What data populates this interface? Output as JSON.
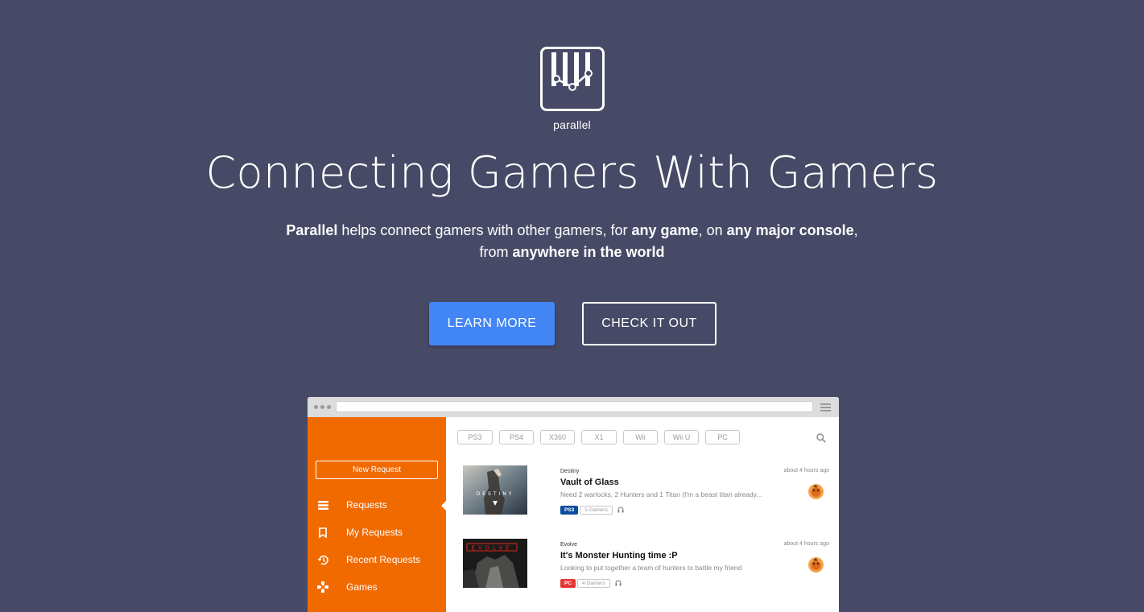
{
  "brand": {
    "name": "parallel"
  },
  "hero": {
    "title": "Connecting Gamers With Gamers",
    "sub_line1_parts": [
      "Parallel",
      " helps connect gamers with other gamers, for ",
      "any game",
      ", on ",
      "any major console",
      ","
    ],
    "sub_line2_parts": [
      "from ",
      "anywhere in the world"
    ]
  },
  "buttons": {
    "learn_more": "LEARN MORE",
    "check_it_out": "CHECK IT OUT"
  },
  "colors": {
    "background": "#474a66",
    "primary": "#4285f4",
    "sidebar": "#f16a00"
  },
  "app": {
    "sidebar": {
      "new_request": "New Request",
      "items": [
        {
          "label": "Requests",
          "icon": "list-icon",
          "active": true
        },
        {
          "label": "My Requests",
          "icon": "bookmark-icon"
        },
        {
          "label": "Recent Requests",
          "icon": "history-icon"
        },
        {
          "label": "Games",
          "icon": "gamepad-icon"
        }
      ]
    },
    "filters": [
      "PS3",
      "PS4",
      "X360",
      "X1",
      "Wii",
      "Wii U",
      "PC"
    ],
    "requests": [
      {
        "game": "Destiny",
        "title": "Vault of Glass",
        "desc": "Need 2 warlocks, 2 Hunters and 1 Titan (I'm a beast titan already...",
        "platform": "PS3",
        "platform_color": "#0a4d9e",
        "gamers": "5 Gamers",
        "time": "about 4 hours ago",
        "thumb_text": "DESTINY"
      },
      {
        "game": "Evolve",
        "title": "It's Monster Hunting time :P",
        "desc": "Looking to put together a team of hunters to battle my friend",
        "platform": "PC",
        "platform_color": "#e53935",
        "gamers": "4 Gamers",
        "time": "about 4 hours ago",
        "thumb_text": "EVOLVE"
      }
    ]
  }
}
